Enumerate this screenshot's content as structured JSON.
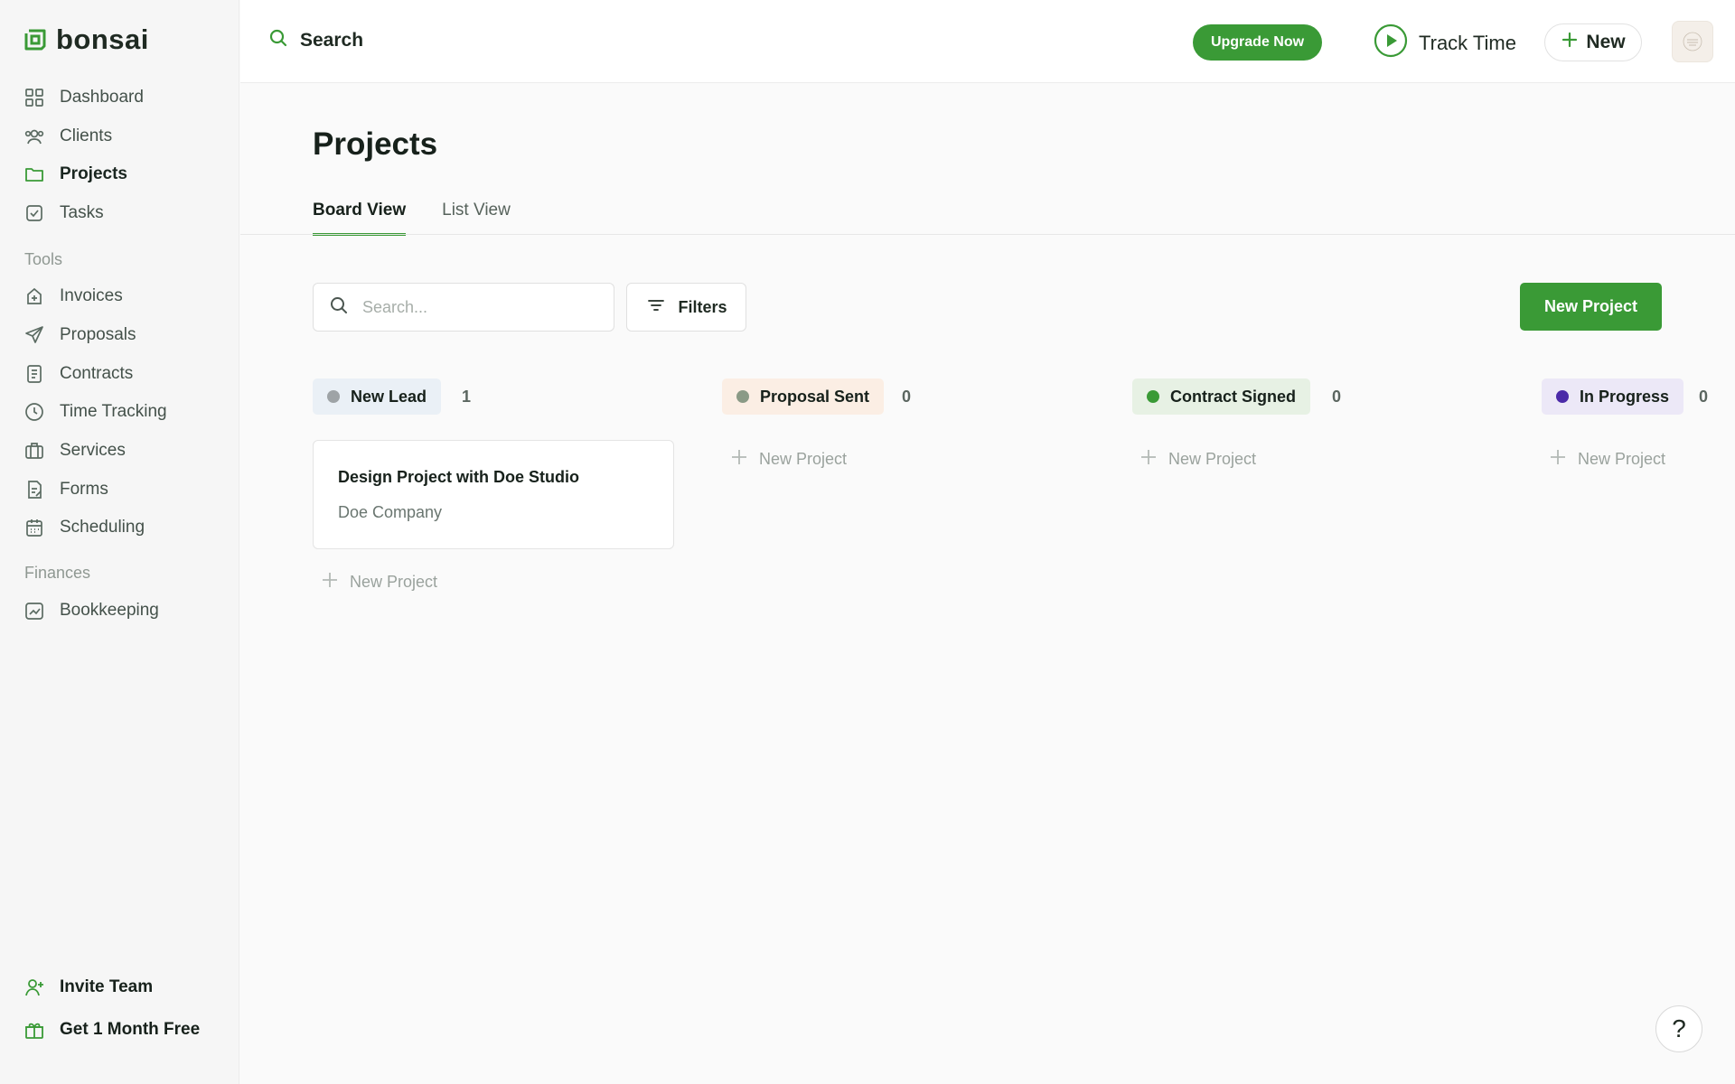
{
  "brand": {
    "name": "bonsai",
    "accent": "#3a9a36"
  },
  "sidebar": {
    "main_items": [
      {
        "label": "Dashboard",
        "icon": "grid-icon"
      },
      {
        "label": "Clients",
        "icon": "users-icon"
      },
      {
        "label": "Projects",
        "icon": "folder-icon",
        "active": true
      },
      {
        "label": "Tasks",
        "icon": "checkbox-icon"
      }
    ],
    "tools_heading": "Tools",
    "tool_items": [
      {
        "label": "Invoices",
        "icon": "invoice-icon"
      },
      {
        "label": "Proposals",
        "icon": "send-icon"
      },
      {
        "label": "Contracts",
        "icon": "document-icon"
      },
      {
        "label": "Time Tracking",
        "icon": "clock-icon"
      },
      {
        "label": "Services",
        "icon": "briefcase-icon"
      },
      {
        "label": "Forms",
        "icon": "form-icon"
      },
      {
        "label": "Scheduling",
        "icon": "calendar-icon"
      }
    ],
    "finances_heading": "Finances",
    "finance_items": [
      {
        "label": "Bookkeeping",
        "icon": "chart-icon"
      }
    ],
    "footer": {
      "invite_label": "Invite Team",
      "free_label": "Get 1 Month Free"
    }
  },
  "topbar": {
    "search_label": "Search",
    "upgrade_label": "Upgrade Now",
    "track_time_label": "Track Time",
    "new_label": "New"
  },
  "main": {
    "title": "Projects",
    "tabs": [
      {
        "label": "Board View",
        "active": true
      },
      {
        "label": "List View",
        "active": false
      }
    ],
    "search_placeholder": "Search...",
    "filters_label": "Filters",
    "new_project_label": "New Project"
  },
  "board": {
    "add_label": "New Project",
    "columns": [
      {
        "name": "New Lead",
        "count": "1",
        "dot_color": "#9ea3a6",
        "pill_bg": "#eaf0f6"
      },
      {
        "name": "Proposal Sent",
        "count": "0",
        "dot_color": "#8a9a86",
        "pill_bg": "#fbeee4"
      },
      {
        "name": "Contract Signed",
        "count": "0",
        "dot_color": "#3a9a36",
        "pill_bg": "#e7f1e4"
      },
      {
        "name": "In Progress",
        "count": "0",
        "dot_color": "#4b2aa8",
        "pill_bg": "#ece8f7"
      }
    ],
    "cards": [
      {
        "title": "Design Project with Doe Studio",
        "client": "Doe Company"
      }
    ]
  }
}
